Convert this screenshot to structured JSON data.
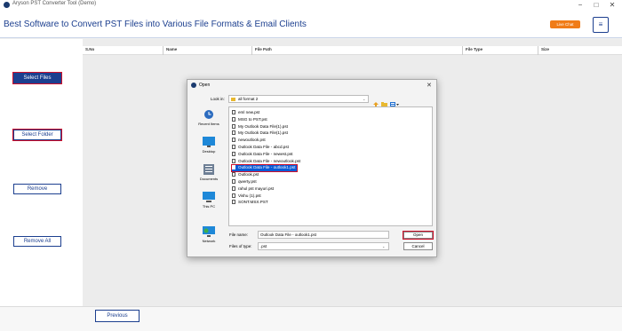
{
  "window": {
    "title": "Aryson PST Converter Tool (Demo)",
    "minimize": "−",
    "maximize": "□",
    "close": "✕"
  },
  "header": {
    "heading": "Best Software to Convert PST Files into Various File Formats & Email Clients",
    "live_chat": "Live Chat",
    "menu_icon": "≡"
  },
  "sidebar": {
    "select_files": "Select Files",
    "select_folder": "Select Folder",
    "remove": "Remove",
    "remove_all": "Remove All"
  },
  "table": {
    "columns": [
      "S.No",
      "Name",
      "File Path",
      "File Type",
      "Size"
    ]
  },
  "footer": {
    "previous": "Previous"
  },
  "dialog": {
    "title": "Open",
    "close": "✕",
    "look_in_label": "Look in:",
    "look_in_value": "all format 2",
    "places": [
      "Recent Items",
      "Desktop",
      "Documents",
      "This PC",
      "Network"
    ],
    "files": [
      "eml new.pst",
      "MSG to PST.pst",
      "My Outlook Data File(1).pst",
      "My Outlook Data File(1).pst",
      "newoutlook.pst",
      "Outlook Data File - abcd.pst",
      "Outlook Data File - newest.pst",
      "Outlook Data File - newoutlook.pst",
      "Outlook Data File - outlook1.pst",
      "Outlook.pst",
      "qwerty.pst",
      "rahul pst mayuri.pst",
      "Vishu (1).pst",
      "SONT.MSX.PST"
    ],
    "selected_index": 8,
    "file_name_label": "File name:",
    "file_name_value": "Outlook Data File - outlook1.pst",
    "file_type_label": "Files of type:",
    "file_type_value": ".pst",
    "open": "Open",
    "cancel": "Cancel"
  }
}
